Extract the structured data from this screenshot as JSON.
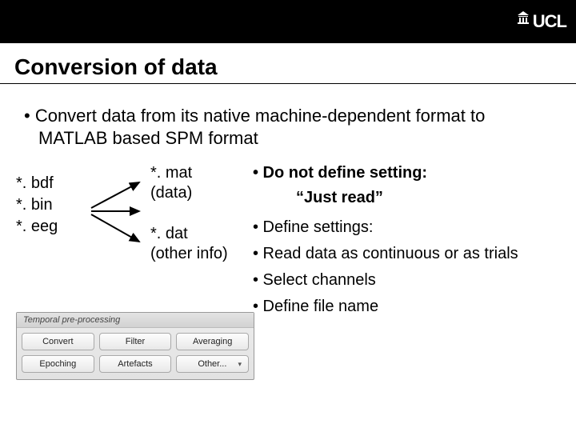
{
  "header": {
    "logo": "UCL"
  },
  "title": "Conversion of data",
  "intro": "•  Convert data from its native machine-dependent format to MATLAB based SPM format",
  "source": {
    "l1": "*. bdf",
    "l2": "*. bin",
    "l3": "*. eeg"
  },
  "output": {
    "mat1": "*. mat",
    "mat2": "(data)",
    "dat1": "*. dat",
    "dat2": "(other info)"
  },
  "bullets": {
    "b1": "• Do not define setting:",
    "b1s": "“Just read”",
    "b2": "• Define settings:",
    "b3": "• Read data as continuous or as trials",
    "b4": "• Select channels",
    "b5": "• Define file name"
  },
  "panel": {
    "title": "Temporal pre-processing",
    "btn1": "Convert",
    "btn2": "Filter",
    "btn3": "Averaging",
    "btn4": "Epoching",
    "btn5": "Artefacts",
    "btn6": "Other..."
  }
}
